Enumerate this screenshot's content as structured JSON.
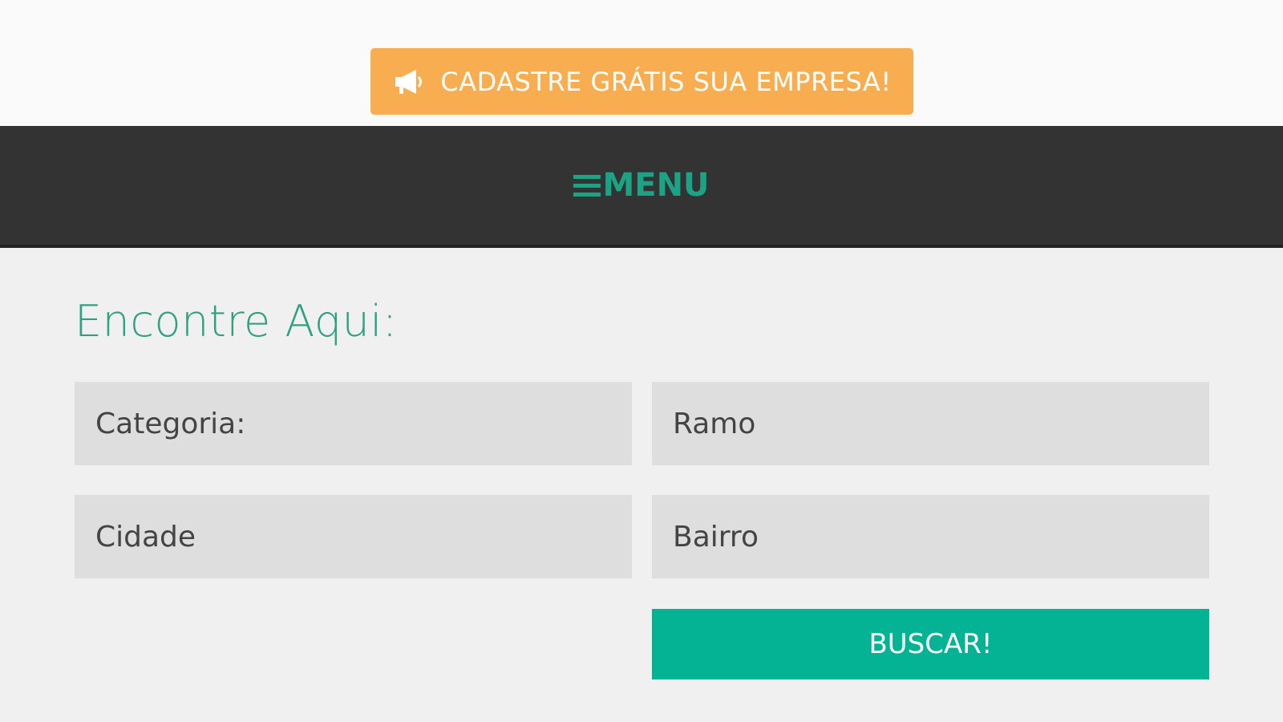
{
  "header": {
    "cta_label": "CADASTRE GRÁTIS SUA EMPRESA!",
    "cta_icon": "megaphone-icon",
    "cta_color": "#f8ad50"
  },
  "nav": {
    "menu_label": "MENU",
    "menu_icon": "hamburger-icon",
    "accent_color": "#1aa385"
  },
  "search": {
    "title": "Encontre Aqui:",
    "fields": {
      "categoria": "Categoria:",
      "ramo": "Ramo",
      "cidade": "Cidade",
      "bairro": "Bairro"
    },
    "submit_label": "BUSCAR!",
    "submit_color": "#04b394"
  }
}
